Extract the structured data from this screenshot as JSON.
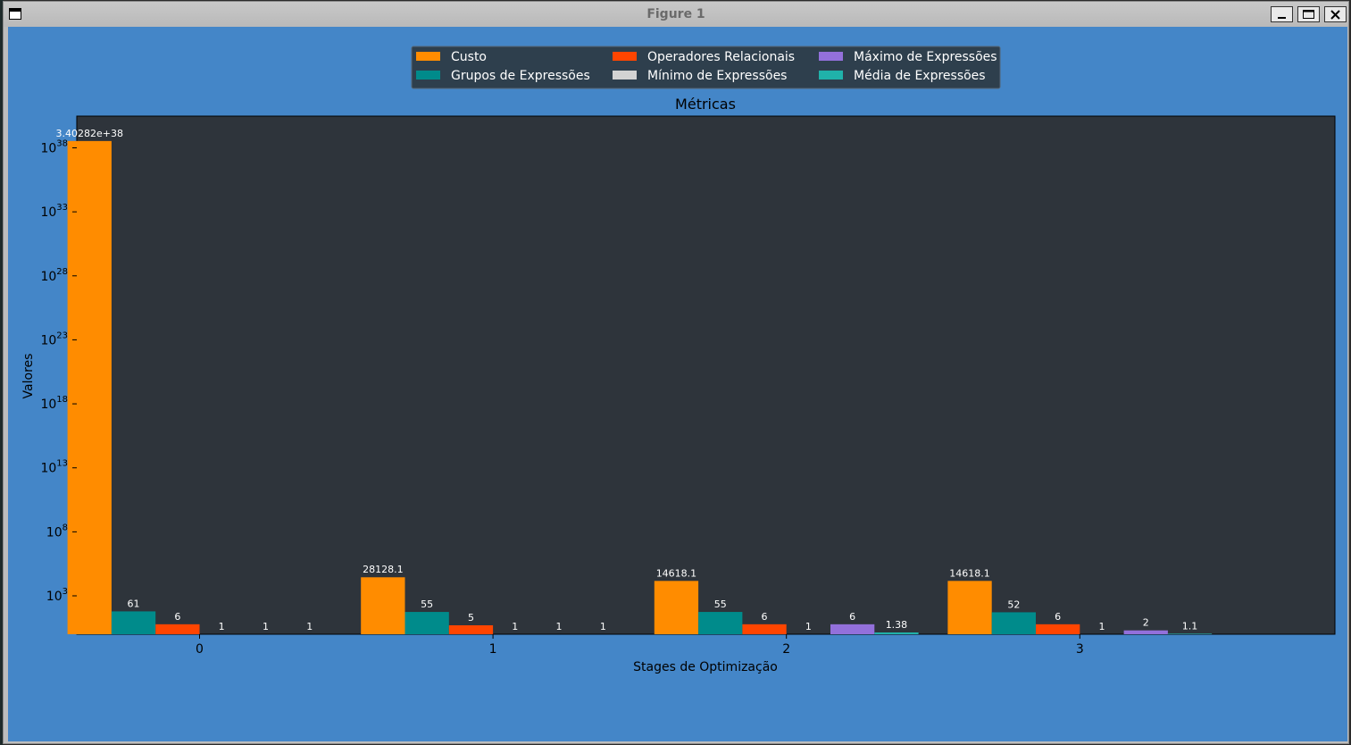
{
  "window": {
    "title": "Figure 1"
  },
  "colors": {
    "figure_bg": "#4486c8",
    "axes_bg": "#2e343b",
    "legend_bg": "#2e3f4d",
    "text_dark": "#000000",
    "text_light": "#ffffff"
  },
  "chart_data": {
    "type": "bar",
    "title": "Métricas",
    "xlabel": "Stages de Optimização",
    "ylabel": "Valores",
    "yscale": "log",
    "ylim": [
      1,
      3e+40
    ],
    "y_ticks": [
      {
        "value": 1000.0,
        "base": "10",
        "exp": "3"
      },
      {
        "value": 100000000.0,
        "base": "10",
        "exp": "8"
      },
      {
        "value": 10000000000000.0,
        "base": "10",
        "exp": "13"
      },
      {
        "value": 1e+18,
        "base": "10",
        "exp": "18"
      },
      {
        "value": 1e+23,
        "base": "10",
        "exp": "23"
      },
      {
        "value": 1e+28,
        "base": "10",
        "exp": "28"
      },
      {
        "value": 1e+33,
        "base": "10",
        "exp": "33"
      },
      {
        "value": 1e+38,
        "base": "10",
        "exp": "38"
      }
    ],
    "categories": [
      "0",
      "1",
      "2",
      "3"
    ],
    "legend_position": "upper center",
    "grid": false,
    "series": [
      {
        "name": "Custo",
        "color": "#ff8c00",
        "values": [
          3.40282e+38,
          28128.1,
          14618.1,
          14618.1
        ],
        "labels": [
          "3.40282e+38",
          "28128.1",
          "14618.1",
          "14618.1"
        ]
      },
      {
        "name": "Grupos de Expressões",
        "color": "#008b8b",
        "values": [
          61,
          55,
          55,
          52
        ],
        "labels": [
          "61",
          "55",
          "55",
          "52"
        ]
      },
      {
        "name": "Operadores Relacionais",
        "color": "#ff4500",
        "values": [
          6,
          5,
          6,
          6
        ],
        "labels": [
          "6",
          "5",
          "6",
          "6"
        ]
      },
      {
        "name": "Mínimo de Expressões",
        "color": "#d3d3d3",
        "values": [
          1,
          1,
          1,
          1
        ],
        "labels": [
          "1",
          "1",
          "1",
          "1"
        ]
      },
      {
        "name": "Máximo de Expressões",
        "color": "#9370db",
        "values": [
          1,
          1,
          6,
          2
        ],
        "labels": [
          "1",
          "1",
          "6",
          "2"
        ]
      },
      {
        "name": "Média de Expressões",
        "color": "#20b2aa",
        "values": [
          1,
          1,
          1.38,
          1.1
        ],
        "labels": [
          "1",
          "1",
          "1.38",
          "1.1"
        ]
      }
    ]
  }
}
